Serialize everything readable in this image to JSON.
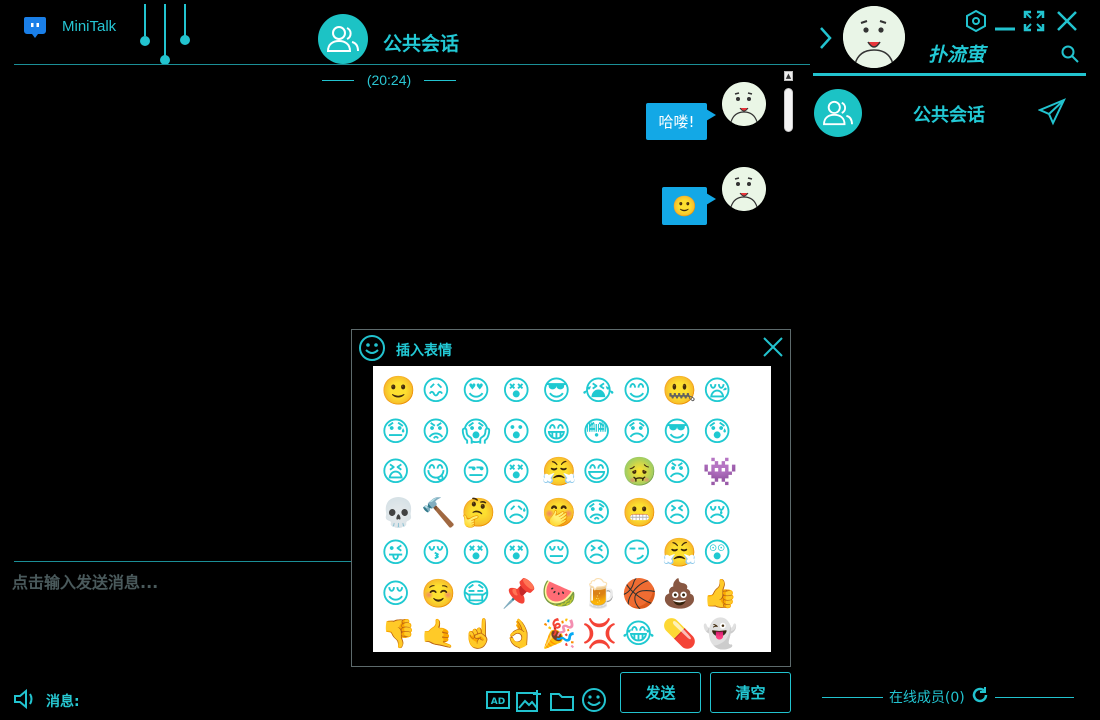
{
  "app": {
    "name": "MiniTalk"
  },
  "chat": {
    "title": "公共会话",
    "time": "(20:24)"
  },
  "messages": [
    {
      "text": "哈喽!"
    },
    {
      "text": "🙂"
    }
  ],
  "input": {
    "placeholder": "点击输入发送消息...",
    "msg_label": "消息:"
  },
  "toolbar": {
    "icons": [
      "ad-icon",
      "image-icon",
      "folder-icon",
      "emoji-icon"
    ]
  },
  "buttons": {
    "send": "发送",
    "clear": "清空"
  },
  "right_panel": {
    "username": "扑流萤",
    "conversations": [
      {
        "name": "公共会话"
      }
    ],
    "online_label": "在线成员(0)"
  },
  "emoji_dialog": {
    "title": "插入表情",
    "emojis": [
      "🙂",
      "😖",
      "😍",
      "😵",
      "😎",
      "😭",
      "😊",
      "🤐",
      "😪",
      "😓",
      "😡",
      "😱",
      "😮",
      "😁",
      "😳",
      "😞",
      "😎",
      "😰",
      "😫",
      "😋",
      "😒",
      "😵",
      "😤",
      "😄",
      "🤢",
      "😠",
      "👾",
      "💀",
      "🔨",
      "🤔",
      "😥",
      "🤭",
      "😟",
      "😬",
      "😣",
      "😢",
      "😜",
      "😚",
      "😵",
      "😵",
      "😔",
      "😣",
      "😏",
      "😤",
      "😲",
      "😌",
      "☺️",
      "😷",
      "📌",
      "🍉",
      "🍺",
      "🏀",
      "💩",
      "👍",
      "👎",
      "🤙",
      "☝️",
      "👌",
      "🎉",
      "💢",
      "😂",
      "💊",
      "👻"
    ]
  },
  "colors": {
    "accent": "#22c3cf",
    "bubble": "#13a8e6",
    "background": "#000000"
  }
}
